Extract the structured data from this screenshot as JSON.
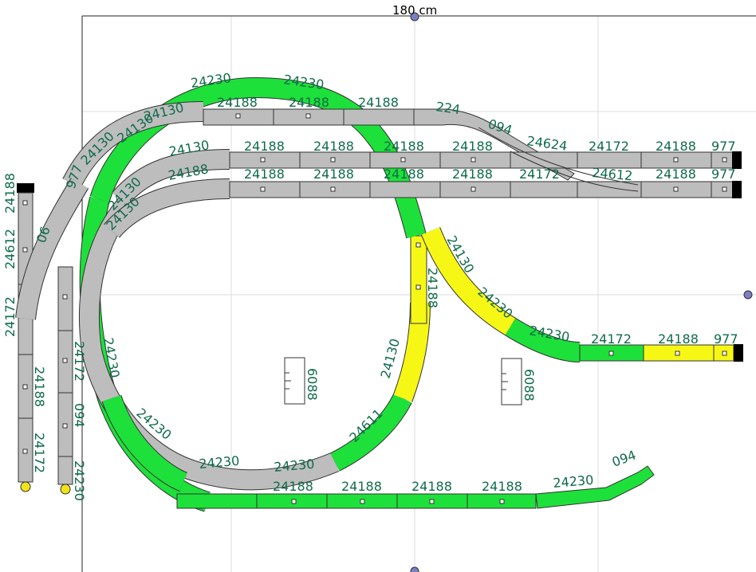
{
  "board": {
    "width_label": "180 cm"
  },
  "track_labels": [
    "24230",
    "24230",
    "24188",
    "24188",
    "24188",
    "224",
    "24130",
    "24130",
    "24130",
    "24188",
    "24188",
    "24188",
    "24188",
    "24188",
    "977",
    "24130",
    "24188",
    "24188",
    "24188",
    "24188",
    "24172",
    "24188",
    "977",
    "094",
    "24624",
    "24612",
    "24172",
    "24188",
    "24130",
    "24130",
    "24130",
    "24172",
    "24188",
    "977",
    "24230",
    "24230",
    "24188",
    "24130",
    "24611",
    "06",
    "977",
    "24188",
    "24612",
    "24172",
    "24188",
    "24172",
    "24172",
    "094",
    "24230",
    "24230",
    "24230",
    "24230",
    "24230",
    "24188",
    "24188",
    "24188",
    "24188",
    "24230",
    "094",
    "6088",
    "6088"
  ]
}
